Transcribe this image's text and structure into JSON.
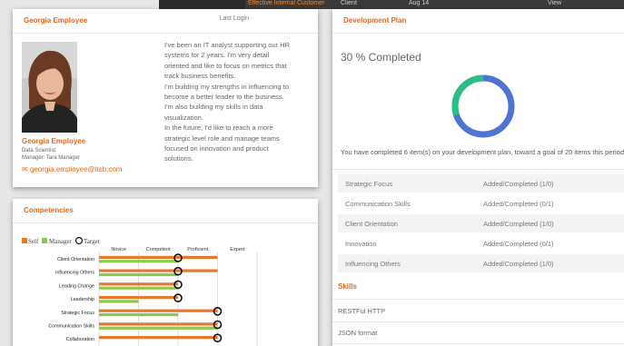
{
  "background": {
    "link_text": "Effective Internal Customer",
    "col_client": "Client",
    "date_text": "Aug 14",
    "action_text": "View"
  },
  "profile": {
    "title": "Georgia Employee",
    "last_login_label": "Last Login",
    "name": "Georgia Employee",
    "job_title": "Data Scientist",
    "manager": "Manager: Tara Manager",
    "email": "georgia.employee@itsb.com",
    "bio_lines": [
      "I've been an IT analyst supporting our HR",
      "systems for 2 years. I'm very detail",
      "oriented and like to focus on metrics that",
      "track business benefits.",
      "I'm building my strengths in influencing to",
      "become a better leader to the business.",
      "I'm also building my skills in data",
      "visualization.",
      "In the future, I'd like to reach a more",
      "strategic level role and manage teams",
      "focused on innovation and product",
      "solutions."
    ]
  },
  "competencies": {
    "title": "Competencies",
    "chart_data": {
      "type": "bar",
      "orientation": "horizontal",
      "levels": [
        "Novice",
        "Competent",
        "Proficient",
        "Expert"
      ],
      "xlim": [
        0,
        4
      ],
      "categories": [
        "Client Orientation",
        "Influencing Others",
        "Leading Change",
        "Leadership",
        "Strategic Focus",
        "Communication Skills",
        "Collaboration"
      ],
      "series": [
        {
          "name": "Self",
          "color": "#e8782a",
          "values": [
            3.0,
            3.0,
            2.0,
            2.0,
            3.0,
            3.0,
            3.0
          ]
        },
        {
          "name": "Manager",
          "color": "#8dc94e",
          "values": [
            2.0,
            2.0,
            2.0,
            1.0,
            2.0,
            3.0,
            null
          ]
        },
        {
          "name": "Target",
          "marker": "circle",
          "values": [
            2.0,
            2.0,
            2.0,
            2.0,
            3.0,
            3.0,
            3.0
          ]
        }
      ],
      "legend_position": "top-left"
    }
  },
  "dev_plan": {
    "title": "Development Plan",
    "percent_text": "30 % Completed",
    "percent_completed": 30,
    "colors": {
      "completed": "#2bbf84",
      "remaining": "#4f74d4"
    },
    "summary": "You have completed 6 item(s) on your development plan, toward a goal of 20 items this period.",
    "rows": [
      {
        "name": "Strategic Focus",
        "status": "Added/Completed (1/0)"
      },
      {
        "name": "Communication Skills",
        "status": "Added/Completed (0/1)"
      },
      {
        "name": "Client Orientation",
        "status": "Added/Completed (1/0)"
      },
      {
        "name": "Innovation",
        "status": "Added/Completed (0/1)"
      },
      {
        "name": "Influencing Others",
        "status": "Added/Completed (1/0)"
      }
    ],
    "skills_title": "Skills",
    "skills": [
      "RESTFul HTTP",
      "JSON format"
    ]
  }
}
